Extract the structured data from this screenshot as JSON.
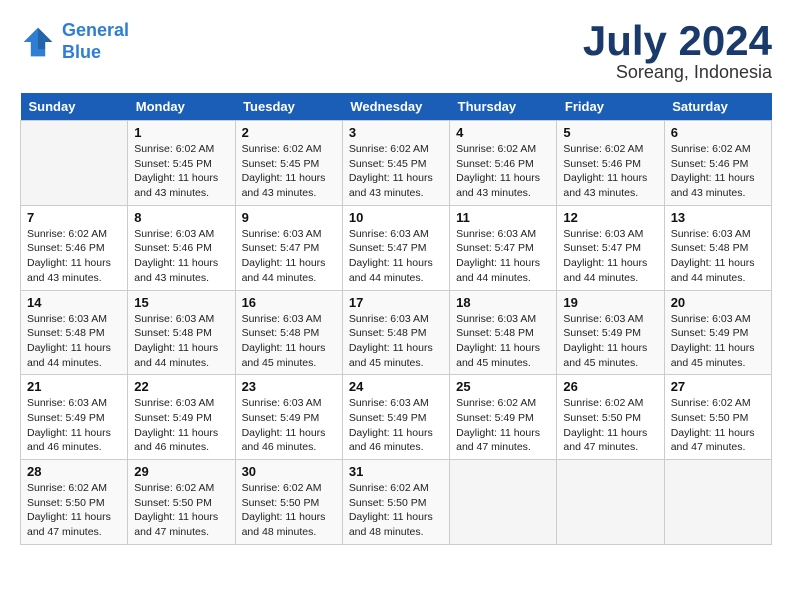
{
  "logo": {
    "line1": "General",
    "line2": "Blue"
  },
  "title": "July 2024",
  "subtitle": "Soreang, Indonesia",
  "days_header": [
    "Sunday",
    "Monday",
    "Tuesday",
    "Wednesday",
    "Thursday",
    "Friday",
    "Saturday"
  ],
  "weeks": [
    [
      {
        "day": "",
        "info": ""
      },
      {
        "day": "1",
        "info": "Sunrise: 6:02 AM\nSunset: 5:45 PM\nDaylight: 11 hours\nand 43 minutes."
      },
      {
        "day": "2",
        "info": "Sunrise: 6:02 AM\nSunset: 5:45 PM\nDaylight: 11 hours\nand 43 minutes."
      },
      {
        "day": "3",
        "info": "Sunrise: 6:02 AM\nSunset: 5:45 PM\nDaylight: 11 hours\nand 43 minutes."
      },
      {
        "day": "4",
        "info": "Sunrise: 6:02 AM\nSunset: 5:46 PM\nDaylight: 11 hours\nand 43 minutes."
      },
      {
        "day": "5",
        "info": "Sunrise: 6:02 AM\nSunset: 5:46 PM\nDaylight: 11 hours\nand 43 minutes."
      },
      {
        "day": "6",
        "info": "Sunrise: 6:02 AM\nSunset: 5:46 PM\nDaylight: 11 hours\nand 43 minutes."
      }
    ],
    [
      {
        "day": "7",
        "info": "Sunrise: 6:02 AM\nSunset: 5:46 PM\nDaylight: 11 hours\nand 43 minutes."
      },
      {
        "day": "8",
        "info": "Sunrise: 6:03 AM\nSunset: 5:46 PM\nDaylight: 11 hours\nand 43 minutes."
      },
      {
        "day": "9",
        "info": "Sunrise: 6:03 AM\nSunset: 5:47 PM\nDaylight: 11 hours\nand 44 minutes."
      },
      {
        "day": "10",
        "info": "Sunrise: 6:03 AM\nSunset: 5:47 PM\nDaylight: 11 hours\nand 44 minutes."
      },
      {
        "day": "11",
        "info": "Sunrise: 6:03 AM\nSunset: 5:47 PM\nDaylight: 11 hours\nand 44 minutes."
      },
      {
        "day": "12",
        "info": "Sunrise: 6:03 AM\nSunset: 5:47 PM\nDaylight: 11 hours\nand 44 minutes."
      },
      {
        "day": "13",
        "info": "Sunrise: 6:03 AM\nSunset: 5:48 PM\nDaylight: 11 hours\nand 44 minutes."
      }
    ],
    [
      {
        "day": "14",
        "info": "Sunrise: 6:03 AM\nSunset: 5:48 PM\nDaylight: 11 hours\nand 44 minutes."
      },
      {
        "day": "15",
        "info": "Sunrise: 6:03 AM\nSunset: 5:48 PM\nDaylight: 11 hours\nand 44 minutes."
      },
      {
        "day": "16",
        "info": "Sunrise: 6:03 AM\nSunset: 5:48 PM\nDaylight: 11 hours\nand 45 minutes."
      },
      {
        "day": "17",
        "info": "Sunrise: 6:03 AM\nSunset: 5:48 PM\nDaylight: 11 hours\nand 45 minutes."
      },
      {
        "day": "18",
        "info": "Sunrise: 6:03 AM\nSunset: 5:48 PM\nDaylight: 11 hours\nand 45 minutes."
      },
      {
        "day": "19",
        "info": "Sunrise: 6:03 AM\nSunset: 5:49 PM\nDaylight: 11 hours\nand 45 minutes."
      },
      {
        "day": "20",
        "info": "Sunrise: 6:03 AM\nSunset: 5:49 PM\nDaylight: 11 hours\nand 45 minutes."
      }
    ],
    [
      {
        "day": "21",
        "info": "Sunrise: 6:03 AM\nSunset: 5:49 PM\nDaylight: 11 hours\nand 46 minutes."
      },
      {
        "day": "22",
        "info": "Sunrise: 6:03 AM\nSunset: 5:49 PM\nDaylight: 11 hours\nand 46 minutes."
      },
      {
        "day": "23",
        "info": "Sunrise: 6:03 AM\nSunset: 5:49 PM\nDaylight: 11 hours\nand 46 minutes."
      },
      {
        "day": "24",
        "info": "Sunrise: 6:03 AM\nSunset: 5:49 PM\nDaylight: 11 hours\nand 46 minutes."
      },
      {
        "day": "25",
        "info": "Sunrise: 6:02 AM\nSunset: 5:49 PM\nDaylight: 11 hours\nand 47 minutes."
      },
      {
        "day": "26",
        "info": "Sunrise: 6:02 AM\nSunset: 5:50 PM\nDaylight: 11 hours\nand 47 minutes."
      },
      {
        "day": "27",
        "info": "Sunrise: 6:02 AM\nSunset: 5:50 PM\nDaylight: 11 hours\nand 47 minutes."
      }
    ],
    [
      {
        "day": "28",
        "info": "Sunrise: 6:02 AM\nSunset: 5:50 PM\nDaylight: 11 hours\nand 47 minutes."
      },
      {
        "day": "29",
        "info": "Sunrise: 6:02 AM\nSunset: 5:50 PM\nDaylight: 11 hours\nand 47 minutes."
      },
      {
        "day": "30",
        "info": "Sunrise: 6:02 AM\nSunset: 5:50 PM\nDaylight: 11 hours\nand 48 minutes."
      },
      {
        "day": "31",
        "info": "Sunrise: 6:02 AM\nSunset: 5:50 PM\nDaylight: 11 hours\nand 48 minutes."
      },
      {
        "day": "",
        "info": ""
      },
      {
        "day": "",
        "info": ""
      },
      {
        "day": "",
        "info": ""
      }
    ]
  ]
}
